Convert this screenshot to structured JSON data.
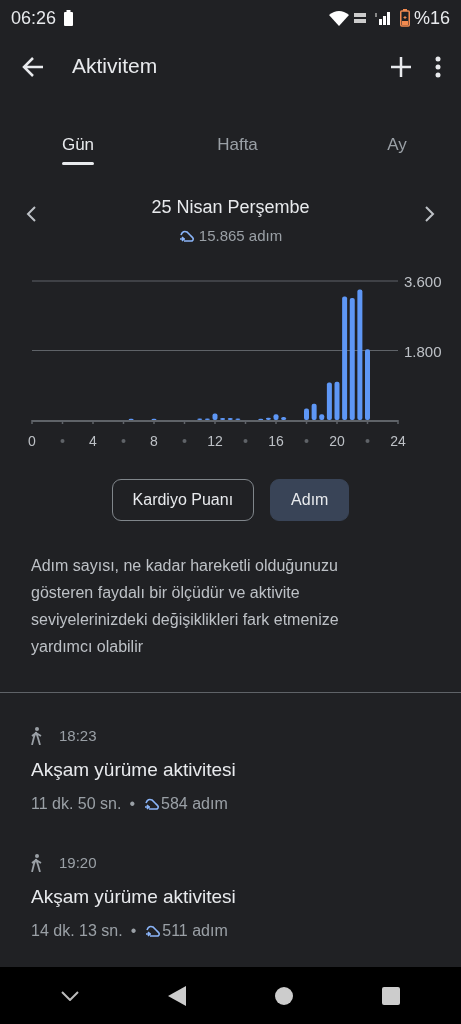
{
  "status_bar": {
    "time": "06:26",
    "battery": "%16"
  },
  "app_bar": {
    "title": "Aktivitem"
  },
  "tabs": [
    {
      "label": "Gün",
      "selected": true
    },
    {
      "label": "Hafta",
      "selected": false
    },
    {
      "label": "Ay",
      "selected": false
    }
  ],
  "day": {
    "date": "25 Nisan Perşembe",
    "steps": "15.865 adım"
  },
  "chart_data": {
    "type": "bar",
    "x": [
      6.5,
      8,
      11,
      11.5,
      12,
      12.5,
      13,
      13.5,
      15,
      15.5,
      16,
      16.5,
      18,
      18.5,
      19,
      19.5,
      20,
      20.5,
      21,
      21.5,
      22
    ],
    "series": [
      {
        "color": "#5e97f6",
        "values": [
          30,
          30,
          40,
          40,
          170,
          50,
          50,
          40,
          30,
          60,
          150,
          80,
          300,
          420,
          150,
          970,
          990,
          3200,
          3160,
          3380,
          1830
        ]
      }
    ],
    "xlim": [
      0,
      24
    ],
    "ylim": [
      0,
      3600
    ],
    "xticks": [
      0,
      4,
      8,
      12,
      16,
      20,
      24
    ],
    "yticks": [
      {
        "value": 1800,
        "label": "1.800"
      },
      {
        "value": 3600,
        "label": "3.600"
      }
    ]
  },
  "metric_buttons": [
    {
      "label": "Kardiyo Puanı",
      "selected": false
    },
    {
      "label": "Adım",
      "selected": true
    }
  ],
  "description": "Adım sayısı, ne kadar hareketli olduğunuzu gösteren faydalı bir ölçüdür ve aktivite seviyelerinizdeki değişiklikleri fark etmenize yardımcı olabilir",
  "activities": [
    {
      "time": "18:23",
      "title": "Akşam yürüme aktivitesi",
      "duration": "11 dk. 50 sn.",
      "separator": "•",
      "steps": "584 adım"
    },
    {
      "time": "19:20",
      "title": "Akşam yürüme aktivitesi",
      "duration": "14 dk. 13 sn.",
      "separator": "•",
      "steps": "511 adım"
    }
  ]
}
